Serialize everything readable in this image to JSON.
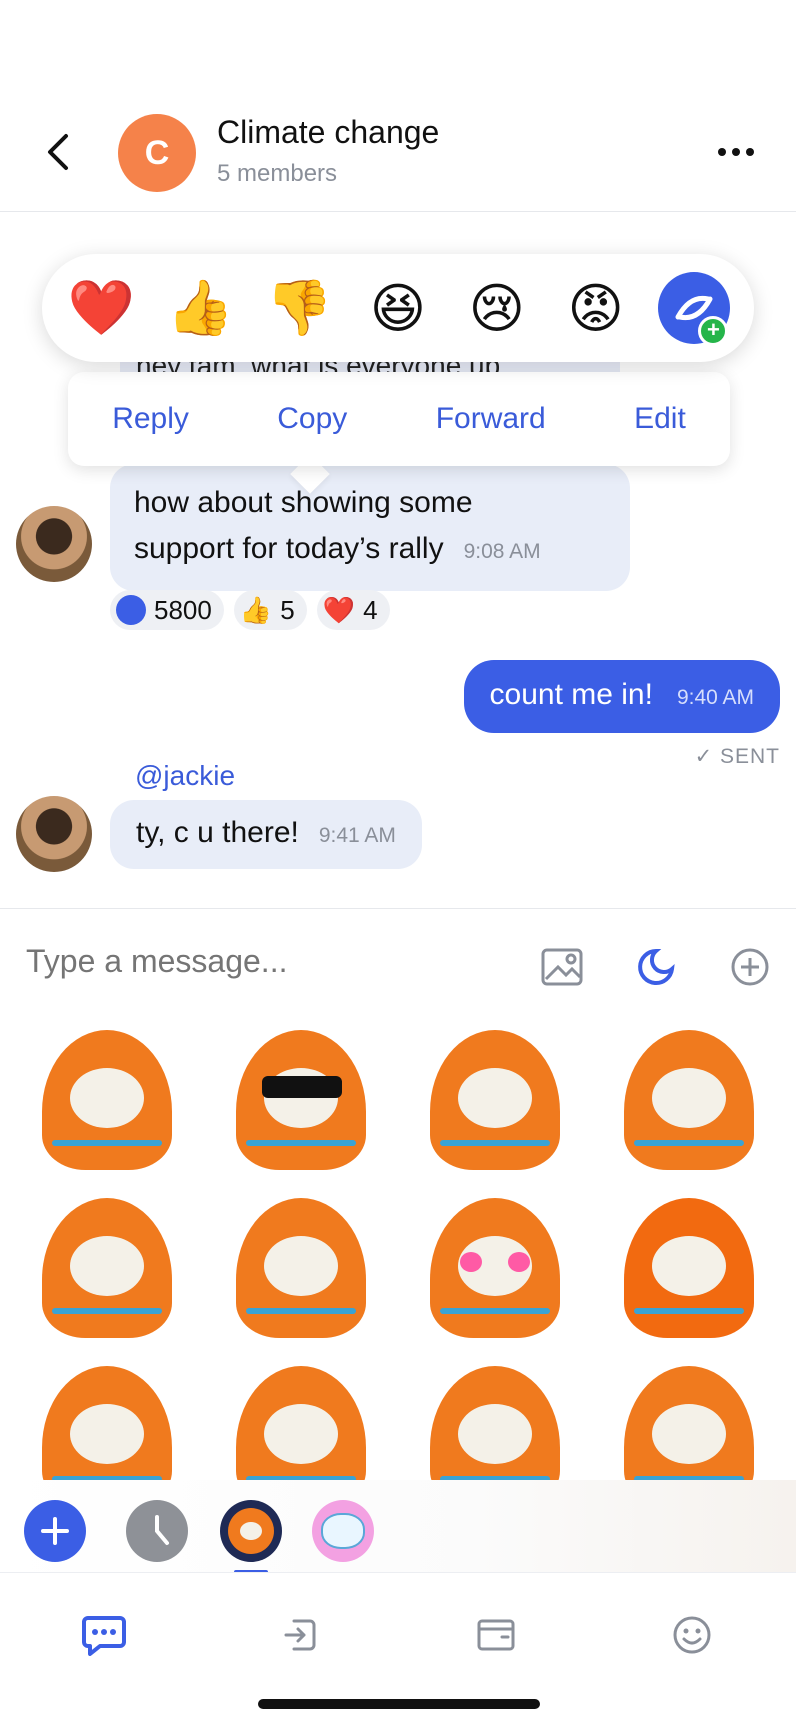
{
  "header": {
    "avatar_initial": "C",
    "title": "Climate change",
    "subtitle": "5 members"
  },
  "reaction_picker": {
    "items": [
      {
        "name": "heart",
        "glyph": "❤️"
      },
      {
        "name": "thumbs-up",
        "glyph": "👍"
      },
      {
        "name": "thumbs-down",
        "glyph": "👎"
      },
      {
        "name": "laughing",
        "glyph": "😆"
      },
      {
        "name": "crying",
        "glyph": "😢"
      },
      {
        "name": "angry",
        "glyph": "😡"
      }
    ]
  },
  "faded_message": "hey tam, what is everyone up",
  "context_menu": {
    "reply": "Reply",
    "copy": "Copy",
    "forward": "Forward",
    "edit": "Edit"
  },
  "messages": {
    "m1": {
      "line1": "how about showing some",
      "line2": "support for today’s rally",
      "time": "9:08 AM"
    },
    "m2": {
      "text": "count me in!",
      "time": "9:40 AM",
      "status": "✓ SENT"
    },
    "m3": {
      "mention": "@jackie",
      "text": "ty, c u there!",
      "time": "9:41 AM"
    }
  },
  "message_reactions": [
    {
      "icon": "special-reaction-icon",
      "count": "5800"
    },
    {
      "icon": "thumbs-up",
      "glyph": "👍",
      "count": "5"
    },
    {
      "icon": "heart",
      "glyph": "❤️",
      "count": "4"
    }
  ],
  "composer": {
    "placeholder": "Type a message..."
  },
  "colors": {
    "accent": "#3b5ee5",
    "bubble_in": "#e8edf8",
    "avatar_c": "#f5824a",
    "sticker_orange": "#f07a1e"
  }
}
